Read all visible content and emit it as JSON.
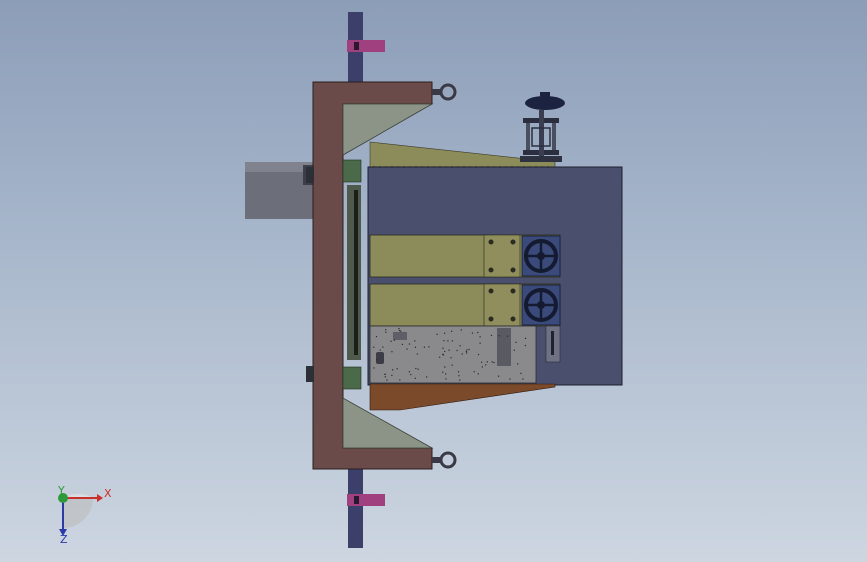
{
  "viewport": {
    "background_top": "#8c9db8",
    "background_bottom": "#cdd6e1"
  },
  "model": {
    "frame_color": "#6b4a4a",
    "gusset_color": "#8c9488",
    "cabinet_color": "#4a4f6e",
    "plate_color": "#8c8b5a",
    "motor_color": "#6c6f7a",
    "pipe_color": "#3b3f6a",
    "clamp_color": "#a0407e",
    "handwheel_color": "#1c2340",
    "base_plate_color": "#8a8a8c",
    "wedge_color": "#7a4a2a"
  },
  "triad": {
    "x_label": "X",
    "y_label": "Y",
    "z_label": "Z",
    "x_color": "#c8302c",
    "y_color": "#2c9a3a",
    "z_color": "#2c3aa8"
  }
}
